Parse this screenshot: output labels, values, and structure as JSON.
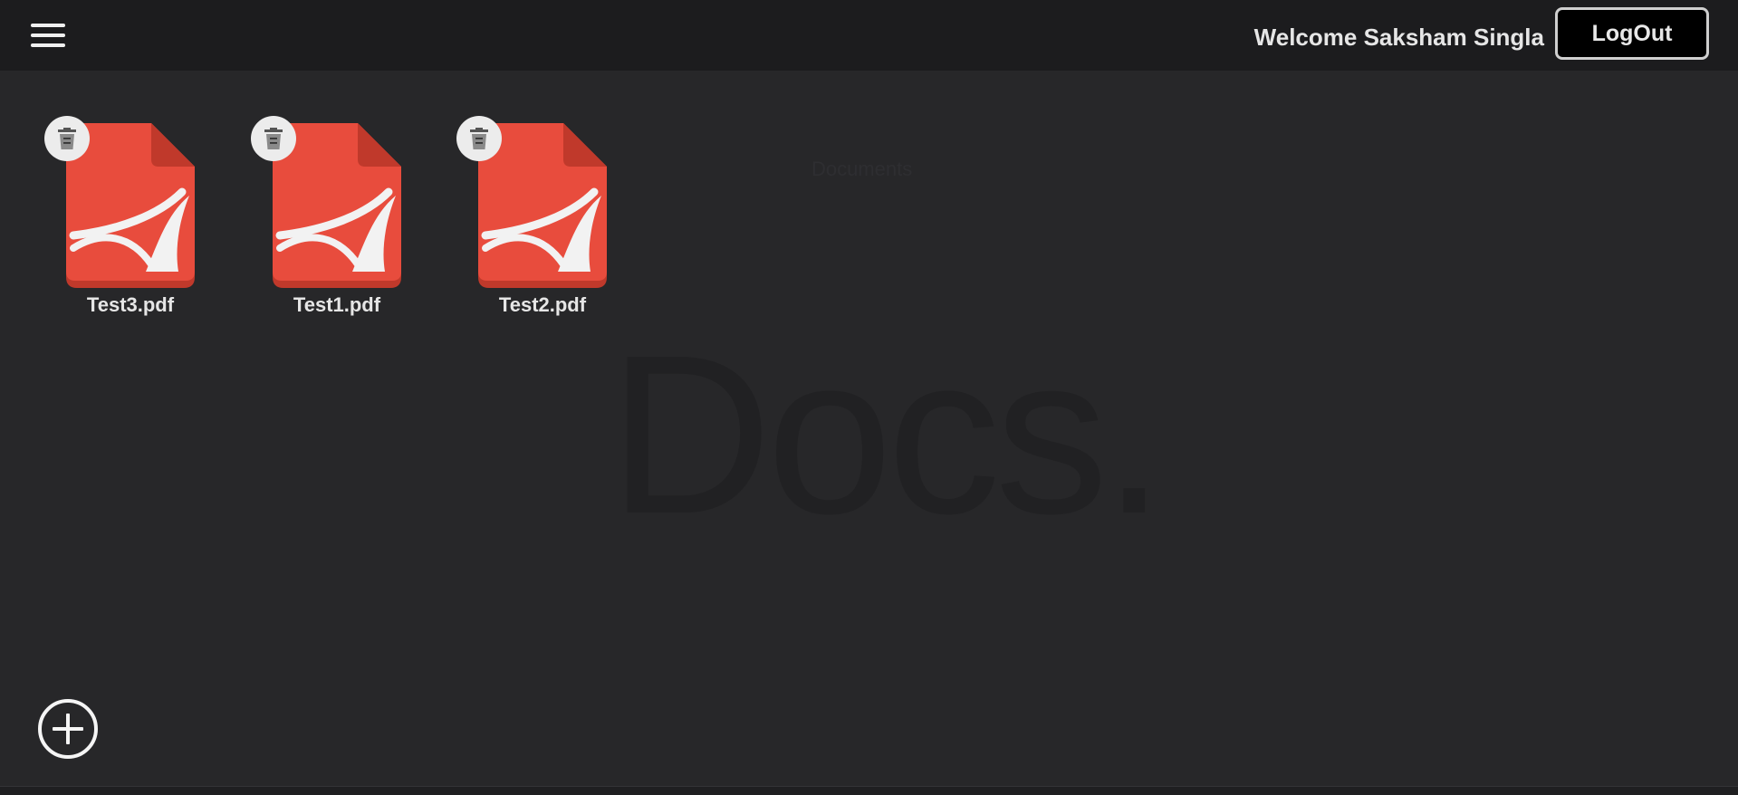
{
  "header": {
    "menu_icon": "hamburger-menu-icon",
    "welcome_text": "Welcome Saksham Singla",
    "logout_label": "LogOut"
  },
  "background": {
    "small_label": "Documents",
    "big_label": "Docs."
  },
  "files": [
    {
      "name": "Test3.pdf",
      "icon": "pdf-file-icon",
      "delete_icon": "trash-icon"
    },
    {
      "name": "Test1.pdf",
      "icon": "pdf-file-icon",
      "delete_icon": "trash-icon"
    },
    {
      "name": "Test2.pdf",
      "icon": "pdf-file-icon",
      "delete_icon": "trash-icon"
    }
  ],
  "actions": {
    "add_icon": "plus-circle-icon"
  },
  "colors": {
    "background": "#272729",
    "topbar": "#1c1c1e",
    "pdf_red": "#e84c3d",
    "pdf_fold": "#c0392b",
    "logout_bg": "#000000"
  }
}
